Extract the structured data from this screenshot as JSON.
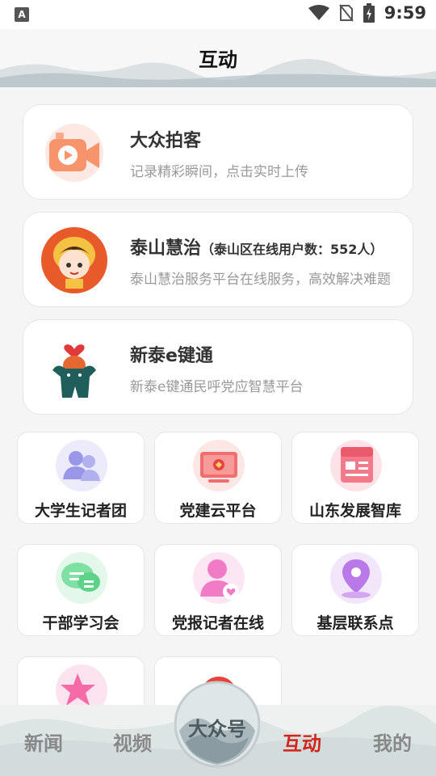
{
  "status": {
    "left_icon_glyph": "A",
    "time": "9:59"
  },
  "header": {
    "title": "互动"
  },
  "cards": [
    {
      "title": "大众拍客",
      "subtitle": "",
      "desc": "记录精彩瞬间，点击实时上传",
      "icon": "video-camera-icon"
    },
    {
      "title": "泰山慧治",
      "subtitle": "（泰山区在线用户数：552人）",
      "desc": "泰山慧治服务平台在线服务，高效解决难题",
      "icon": "mascot-avatar-icon"
    },
    {
      "title": "新泰e键通",
      "subtitle": "",
      "desc": "新泰e键通民呼党应智慧平台",
      "icon": "mascot-heart-icon"
    }
  ],
  "tiles": [
    {
      "label": "大学生记者团",
      "icon": "users-icon"
    },
    {
      "label": "党建云平台",
      "icon": "party-screen-icon"
    },
    {
      "label": "山东发展智库",
      "icon": "news-icon"
    },
    {
      "label": "干部学习会",
      "icon": "chat-bubble-icon"
    },
    {
      "label": "党报记者在线",
      "icon": "user-heart-icon"
    },
    {
      "label": "基层联系点",
      "icon": "location-pin-icon"
    },
    {
      "label": "",
      "icon": "star-icon"
    },
    {
      "label": "",
      "icon": "red-circle-icon"
    }
  ],
  "bottom_nav": {
    "items": [
      "新闻",
      "视频",
      "互动",
      "我的"
    ],
    "center_label": "大众号",
    "active": "互动"
  },
  "colors": {
    "active": "#d0261d",
    "inactive": "#888888"
  }
}
